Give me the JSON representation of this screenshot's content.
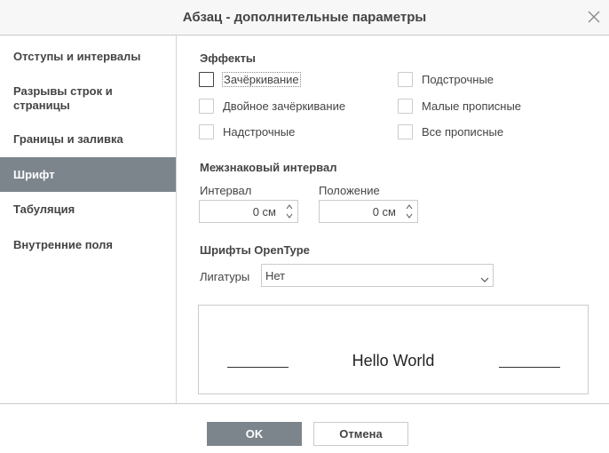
{
  "dialog": {
    "title": "Абзац - дополнительные параметры"
  },
  "sidebar": {
    "items": [
      {
        "label": "Отступы и интервалы"
      },
      {
        "label": "Разрывы строк и страницы"
      },
      {
        "label": "Границы и заливка"
      },
      {
        "label": "Шрифт"
      },
      {
        "label": "Табуляция"
      },
      {
        "label": "Внутренние поля"
      }
    ],
    "active_index": 3
  },
  "effects": {
    "title": "Эффекты",
    "left": [
      {
        "label": "Зачёркивание",
        "checked": false
      },
      {
        "label": "Двойное зачёркивание",
        "checked": false
      },
      {
        "label": "Надстрочные",
        "checked": false
      }
    ],
    "right": [
      {
        "label": "Подстрочные",
        "checked": false
      },
      {
        "label": "Малые прописные",
        "checked": false
      },
      {
        "label": "Все прописные",
        "checked": false
      }
    ]
  },
  "spacing": {
    "title": "Межзнаковый интервал",
    "interval_label": "Интервал",
    "interval_value": "0 см",
    "position_label": "Положение",
    "position_value": "0 см"
  },
  "opentype": {
    "title": "Шрифты OpenType",
    "ligatures_label": "Лигатуры",
    "ligatures_value": "Нет"
  },
  "preview": {
    "text": "Hello World"
  },
  "footer": {
    "ok_label": "OK",
    "cancel_label": "Отмена"
  }
}
